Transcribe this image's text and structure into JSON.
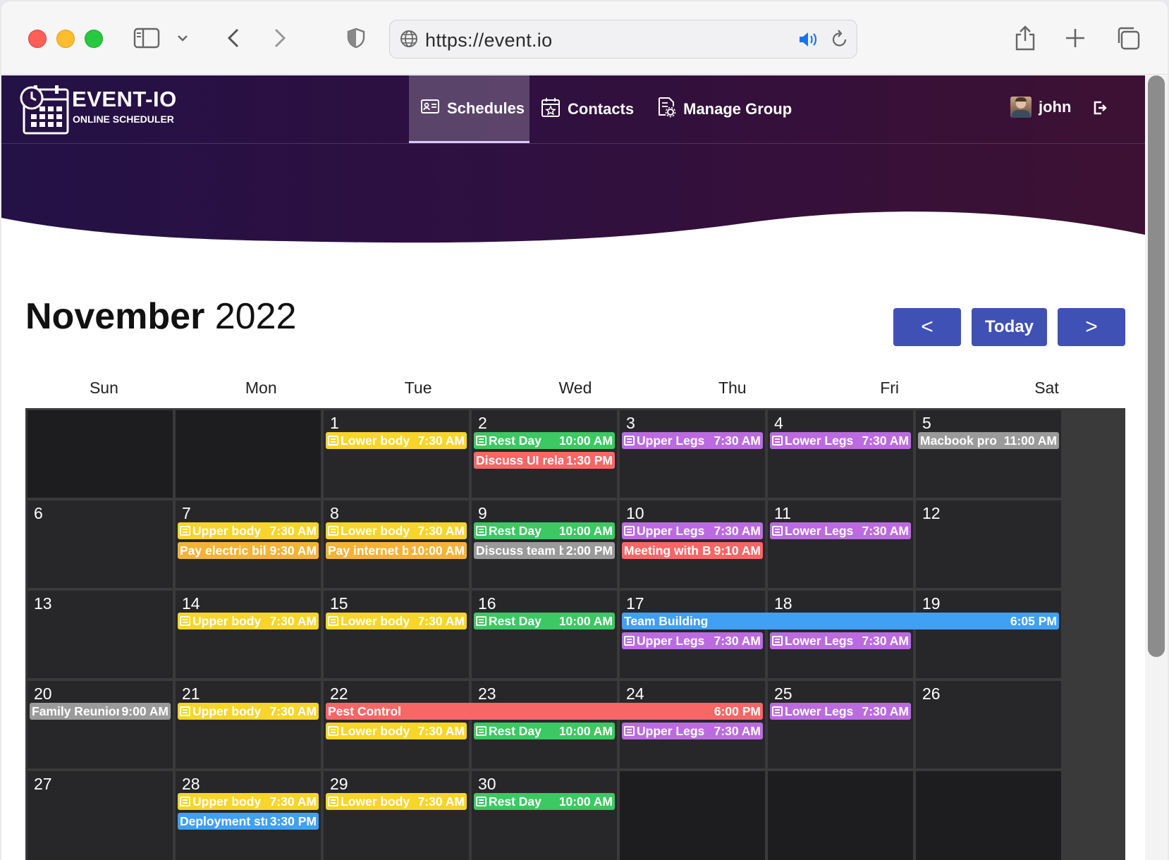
{
  "browser": {
    "url": "https://event.io"
  },
  "brand": {
    "title": "EVENT-IO",
    "subtitle": "ONLINE SCHEDULER"
  },
  "nav": {
    "schedules": "Schedules",
    "contacts": "Contacts",
    "manage_group": "Manage Group"
  },
  "user": {
    "name": "john"
  },
  "calendar": {
    "month": "November",
    "year": "2022",
    "prev_label": "<",
    "today_label": "Today",
    "next_label": ">",
    "weekdays": [
      "Sun",
      "Mon",
      "Tue",
      "Wed",
      "Thu",
      "Fri",
      "Sat"
    ],
    "days": {
      "d1": "1",
      "d2": "2",
      "d3": "3",
      "d4": "4",
      "d5": "5",
      "d6": "6",
      "d7": "7",
      "d8": "8",
      "d9": "9",
      "d10": "10",
      "d11": "11",
      "d12": "12",
      "d13": "13",
      "d14": "14",
      "d15": "15",
      "d16": "16",
      "d17": "17",
      "d18": "18",
      "d19": "19",
      "d20": "20",
      "d21": "21",
      "d22": "22",
      "d23": "23",
      "d24": "24",
      "d25": "25",
      "d26": "26",
      "d27": "27",
      "d28": "28",
      "d29": "29",
      "d30": "30"
    },
    "events": {
      "e1": {
        "title": "Lower body",
        "time": "7:30 AM",
        "color": "#f8d52a"
      },
      "e2": {
        "title": "Rest Day",
        "time": "10:00 AM",
        "color": "#3cc862"
      },
      "e3": {
        "title": "Discuss UI rela...",
        "time": "1:30 PM",
        "color": "#f86666"
      },
      "e4": {
        "title": "Upper Legs",
        "time": "7:30 AM",
        "color": "#bb6bdf"
      },
      "e5": {
        "title": "Lower Legs",
        "time": "7:30 AM",
        "color": "#bb6bdf"
      },
      "e6": {
        "title": "Macbook pro ...",
        "time": "11:00 AM",
        "color": "#9a9a9a"
      },
      "e7": {
        "title": "Upper body",
        "time": "7:30 AM",
        "color": "#f8d52a"
      },
      "e8": {
        "title": "Pay electric bill",
        "time": "9:30 AM",
        "color": "#f5b336"
      },
      "e9": {
        "title": "Lower body",
        "time": "7:30 AM",
        "color": "#f8d52a"
      },
      "e10": {
        "title": "Pay internet bill",
        "time": "10:00 AM",
        "color": "#f5b336"
      },
      "e11": {
        "title": "Rest Day",
        "time": "10:00 AM",
        "color": "#3cc862"
      },
      "e12": {
        "title": "Discuss team b...",
        "time": "2:00 PM",
        "color": "#9a9a9a"
      },
      "e13": {
        "title": "Upper Legs",
        "time": "7:30 AM",
        "color": "#bb6bdf"
      },
      "e14": {
        "title": "Meeting with B...",
        "time": "9:10 AM",
        "color": "#f86666"
      },
      "e15": {
        "title": "Lower Legs",
        "time": "7:30 AM",
        "color": "#bb6bdf"
      },
      "e16": {
        "title": "Upper body",
        "time": "7:30 AM",
        "color": "#f8d52a"
      },
      "e17": {
        "title": "Lower body",
        "time": "7:30 AM",
        "color": "#f8d52a"
      },
      "e18": {
        "title": "Rest Day",
        "time": "10:00 AM",
        "color": "#3cc862"
      },
      "e19": {
        "title": "Team Building",
        "time": "6:05 PM",
        "color": "#3fa0f4"
      },
      "e20": {
        "title": "Upper Legs",
        "time": "7:30 AM",
        "color": "#bb6bdf"
      },
      "e21": {
        "title": "Lower Legs",
        "time": "7:30 AM",
        "color": "#bb6bdf"
      },
      "e22": {
        "title": "Family Reunion",
        "time": "9:00 AM",
        "color": "#9a9a9a"
      },
      "e23": {
        "title": "Upper body",
        "time": "7:30 AM",
        "color": "#f8d52a"
      },
      "e24": {
        "title": "Pest Control",
        "time": "6:00 PM",
        "color": "#f86666"
      },
      "e25": {
        "title": "Lower body",
        "time": "7:30 AM",
        "color": "#f8d52a"
      },
      "e26": {
        "title": "Rest Day",
        "time": "10:00 AM",
        "color": "#3cc862"
      },
      "e27": {
        "title": "Upper Legs",
        "time": "7:30 AM",
        "color": "#bb6bdf"
      },
      "e28": {
        "title": "Lower Legs",
        "time": "7:30 AM",
        "color": "#bb6bdf"
      },
      "e29": {
        "title": "Upper body",
        "time": "7:30 AM",
        "color": "#f8d52a"
      },
      "e30": {
        "title": "Deployment str...",
        "time": "3:30 PM",
        "color": "#3fa0f4"
      },
      "e31": {
        "title": "Lower body",
        "time": "7:30 AM",
        "color": "#f8d52a"
      },
      "e32": {
        "title": "Rest Day",
        "time": "10:00 AM",
        "color": "#3cc862"
      }
    }
  },
  "icons": {
    "sidebar": "sidebar-icon",
    "back": "chevron-left-icon",
    "forward": "chevron-right-icon",
    "shield": "shield-icon",
    "globe": "globe-icon",
    "speaker": "speaker-icon",
    "reload": "reload-icon",
    "share": "share-icon",
    "new_tab": "plus-icon",
    "tabs": "tabs-icon",
    "logout": "logout-icon"
  }
}
